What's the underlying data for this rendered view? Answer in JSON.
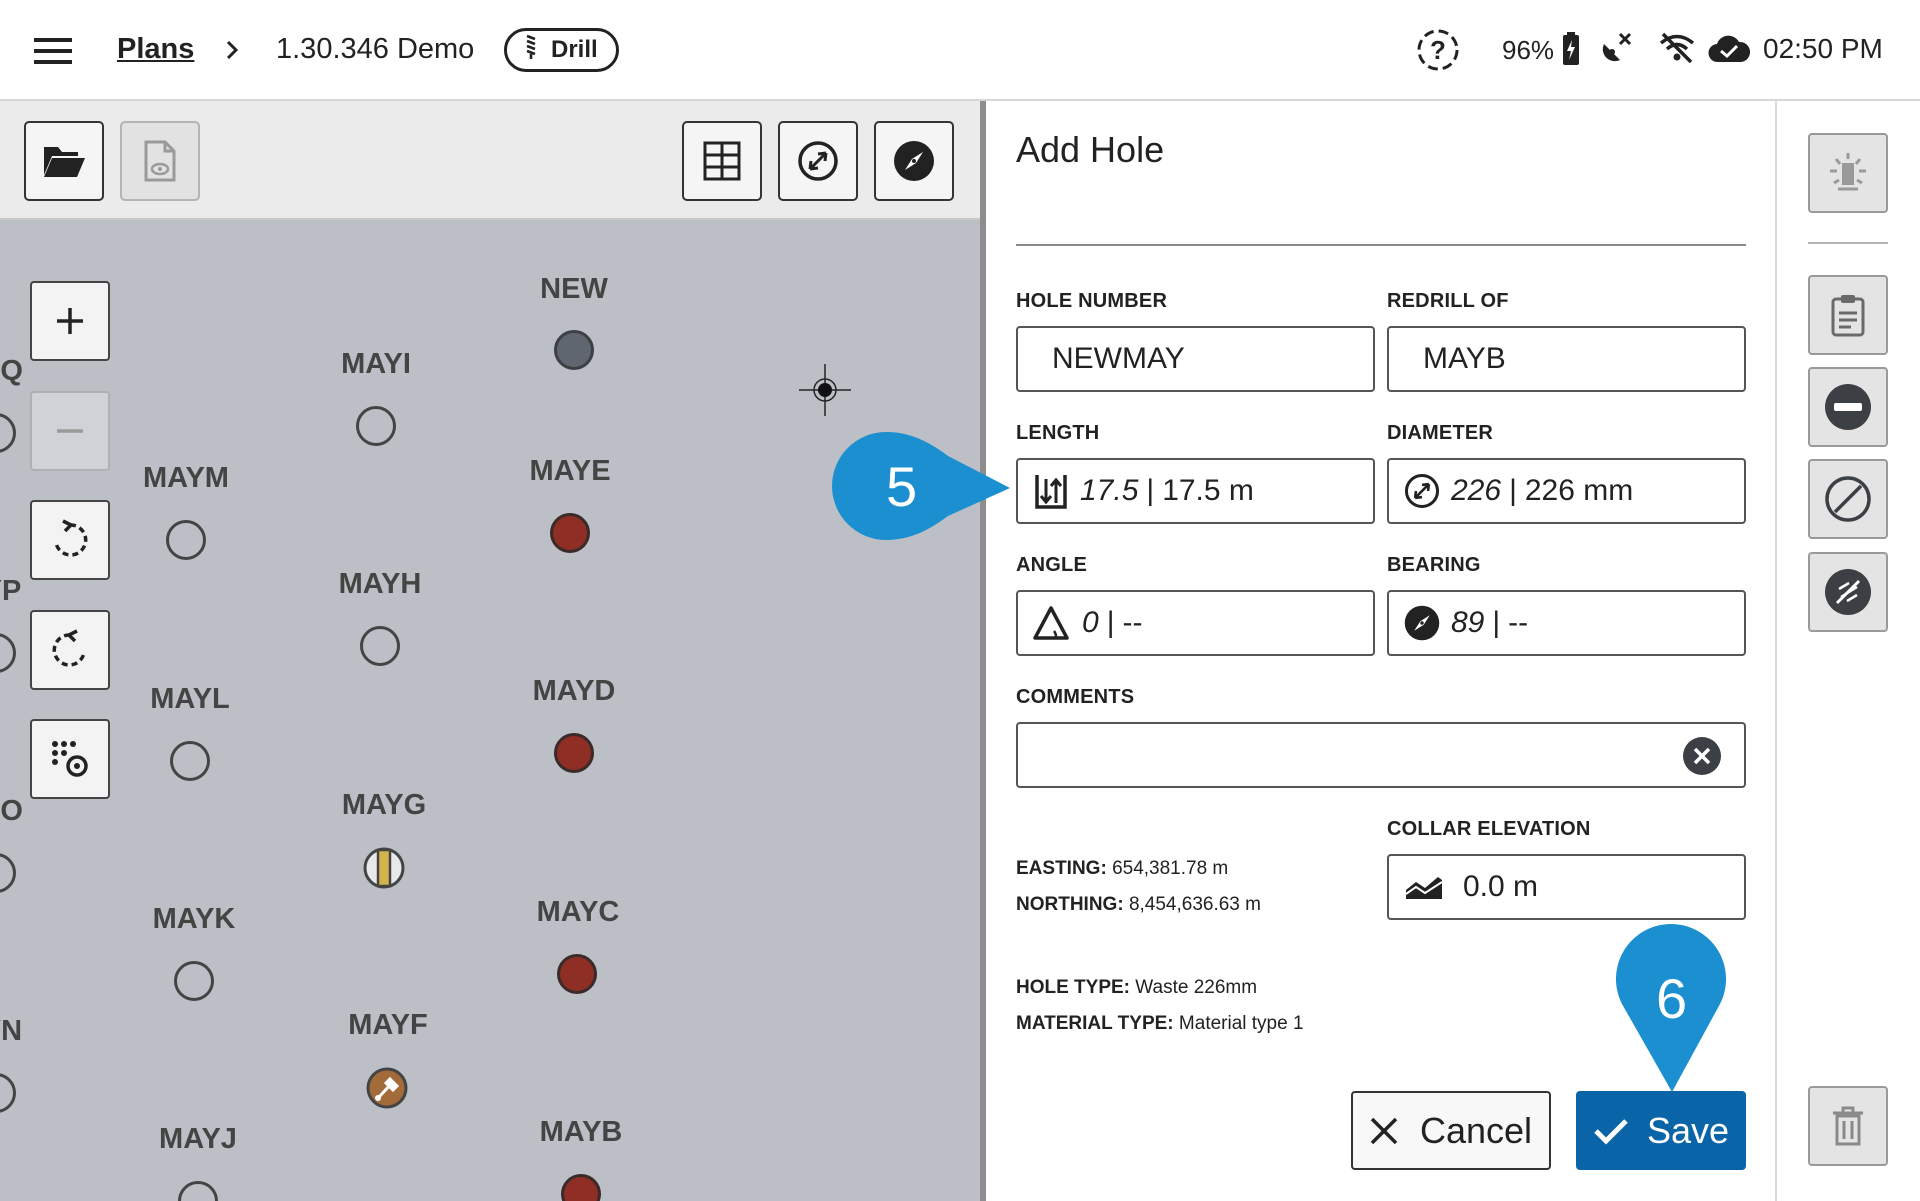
{
  "header": {
    "breadcrumb_root": "Plans",
    "breadcrumb_current": "1.30.346 Demo",
    "mode_pill": "Drill",
    "battery_pct": "96%",
    "time": "02:50 PM"
  },
  "map": {
    "holes": [
      {
        "label": "YQ"
      },
      {
        "label": "YP"
      },
      {
        "label": "YO"
      },
      {
        "label": "YN"
      },
      {
        "label": "MAYM"
      },
      {
        "label": "MAYL"
      },
      {
        "label": "MAYK"
      },
      {
        "label": "MAYJ"
      },
      {
        "label": "MAYI"
      },
      {
        "label": "MAYH"
      },
      {
        "label": "MAYG"
      },
      {
        "label": "MAYF"
      },
      {
        "label": "NEW"
      },
      {
        "label": "MAYE"
      },
      {
        "label": "MAYD"
      },
      {
        "label": "MAYC"
      },
      {
        "label": "MAYB"
      }
    ],
    "colors": {
      "background": "#bcc0c6",
      "drilled": "#8e2e24",
      "new": "#5f6670"
    }
  },
  "panel": {
    "title": "Add Hole",
    "hole_number": {
      "label": "HOLE NUMBER",
      "value": "NEWMAY"
    },
    "redrill_of": {
      "label": "REDRILL OF",
      "value": "MAYB"
    },
    "length": {
      "label": "LENGTH",
      "value": "17.5",
      "suffix": "17.5 m"
    },
    "diameter": {
      "label": "DIAMETER",
      "value": "226",
      "suffix": "226 mm"
    },
    "angle": {
      "label": "ANGLE",
      "value": "0",
      "suffix": "--"
    },
    "bearing": {
      "label": "BEARING",
      "value": "89",
      "suffix": "--"
    },
    "comments": {
      "label": "COMMENTS",
      "value": ""
    },
    "collar_elevation": {
      "label": "COLLAR ELEVATION",
      "value": "0.0 m"
    },
    "easting": {
      "label": "EASTING:",
      "value": "654,381.78 m"
    },
    "northing": {
      "label": "NORTHING:",
      "value": "8,454,636.63 m"
    },
    "hole_type": {
      "label": "HOLE TYPE:",
      "value": "Waste 226mm"
    },
    "material_type": {
      "label": "MATERIAL TYPE:",
      "value": "Material type 1"
    },
    "cancel_label": "Cancel",
    "save_label": "Save"
  },
  "callouts": {
    "step5": "5",
    "step6": "6"
  },
  "colors": {
    "accent": "#0a64a8",
    "callout": "#1b8fd0"
  }
}
